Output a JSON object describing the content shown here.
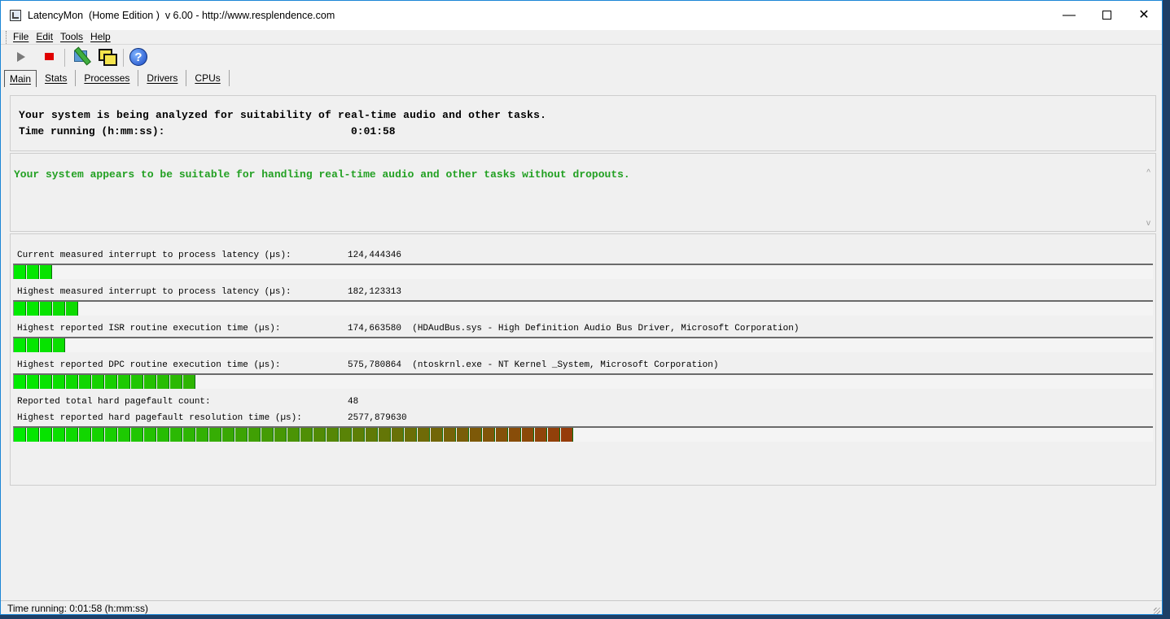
{
  "window": {
    "title": "LatencyMon  (Home Edition )  v 6.00 - http://www.resplendence.com",
    "minimize_glyph": "—",
    "close_glyph": "✕"
  },
  "menu": [
    "File",
    "Edit",
    "Tools",
    "Help"
  ],
  "toolbar": {
    "icons": [
      "play-icon",
      "stop-icon",
      "drivers-icon",
      "windows-icon",
      "help-icon"
    ],
    "help_glyph": "?"
  },
  "tabs": [
    "Main",
    "Stats",
    "Processes",
    "Drivers",
    "CPUs"
  ],
  "info": {
    "line1": "Your system is being analyzed for suitability of real-time audio and other tasks.",
    "time_label": "Time running (h:mm:ss):",
    "time_value": "0:01:58"
  },
  "verdict": {
    "text": "Your system appears to be suitable for handling real-time audio and other tasks without dropouts.",
    "color": "#22a022",
    "scroll_up_glyph": "^",
    "scroll_down_glyph": "v"
  },
  "metrics": [
    {
      "label": "Current measured interrupt to process latency (µs):",
      "value": "124,444346",
      "segments": 3
    },
    {
      "label": "Highest measured interrupt to process latency (µs):",
      "value": "182,123313",
      "segments": 5
    },
    {
      "label": "Highest reported ISR routine execution time (µs):",
      "value": "174,663580  (HDAudBus.sys - High Definition Audio Bus Driver, Microsoft Corporation)",
      "segments": 4
    },
    {
      "label": "Highest reported DPC routine execution time (µs):",
      "value": "575,780864  (ntoskrnl.exe - NT Kernel _System, Microsoft Corporation)",
      "segments": 14
    },
    {
      "label": "Reported total hard pagefault count:",
      "value": "48"
    },
    {
      "label": "Highest reported hard pagefault resolution time (µs):",
      "value": "2577,879630",
      "segments": 43
    }
  ],
  "statusbar": {
    "text": "Time running: 0:01:58  (h:mm:ss)"
  }
}
